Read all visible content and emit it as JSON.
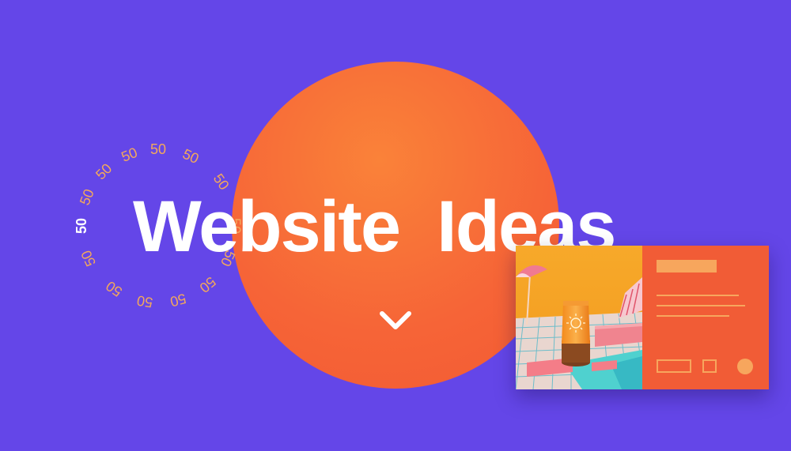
{
  "hero": {
    "title": "Website  Ideas"
  },
  "badge": {
    "number": "50",
    "highlight": "50"
  },
  "icons": {
    "scroll": "chevron-down-icon"
  },
  "colors": {
    "background": "#6446e8",
    "circle": "#f66437",
    "ring_text": "#f3a85c",
    "title": "#ffffff",
    "card_panel": "#f15c36",
    "card_placeholder": "#f7a65d"
  }
}
